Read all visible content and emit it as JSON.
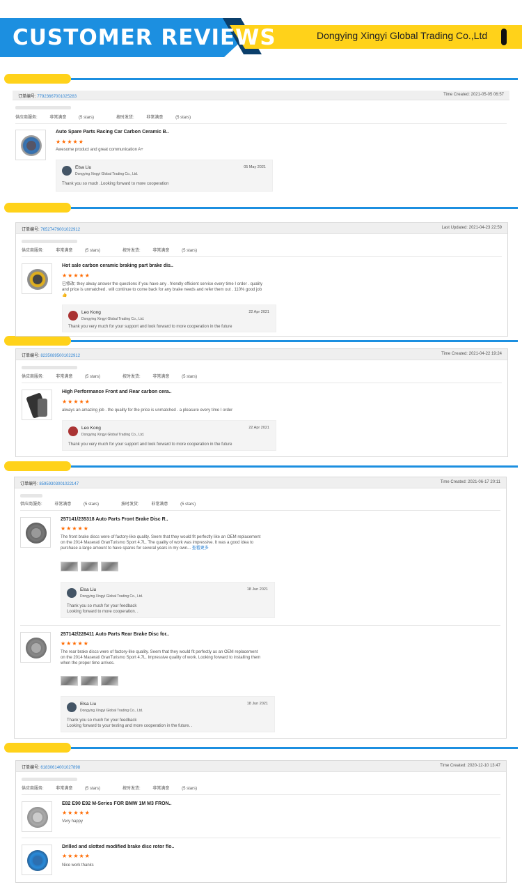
{
  "header": {
    "title": "CUSTOMER REVIEWS",
    "company": "Dongying Xingyi Global Trading Co.,Ltd"
  },
  "labels": {
    "order": "订单编号:",
    "service": "供应商服务:",
    "shipping": "按时发货:",
    "rating": "非常满意",
    "stars": "(5 stars)",
    "star_glyphs": "★★★★★"
  },
  "orders": [
    {
      "number": "77923667001025283",
      "time": "Time Created: 2021-05-05 06:57",
      "items": [
        {
          "name": "Auto Spare Parts Racing Car Carbon Ceramic B..",
          "review": "Awesome product and great communication A+",
          "reply": {
            "name": "Elsa Liu",
            "company": "Dongying Xingyi Global Trading Co., Ltd.",
            "date": "05 May 2021",
            "text": "Thank you so much .Looking forward to more cooperation"
          }
        }
      ]
    },
    {
      "number": "76527479001022912",
      "time": "Last Updated: 2021-04-23 22:59",
      "items": [
        {
          "name": "Hot sale carbon ceramic braking part brake dis..",
          "review": "已修改: they alway answer the questions if you have any . friendly efficient service every time I order . quality and price is unmatched . will continue to come back for any brake  needs and refer them out . 110% good job 👍",
          "reply": {
            "name": "Leo Kong",
            "company": "Dongying Xingyi Global Trading Co., Ltd.",
            "date": "22 Apr 2021",
            "text": "Thank you very much for your support and look forward to more cooperation in the future"
          }
        }
      ]
    },
    {
      "number": "82350895001022912",
      "time": "Time Created: 2021-04-22 19:24",
      "items": [
        {
          "name": "High Performance Front and Rear carbon cera..",
          "review": "always an amazing job . the  quality for the price is unmatched . a pleasure every time I order",
          "reply": {
            "name": "Leo Kong",
            "company": "Dongying Xingyi Global Trading Co., Ltd.",
            "date": "22 Apr 2021",
            "text": "Thank you very much for your support and look forward to more cooperation in the future"
          }
        }
      ]
    },
    {
      "number": "85959303001022147",
      "time": "Time Created: 2021-06-17 20:11",
      "items": [
        {
          "name": "257141/235318 Auto Parts Front Brake Disc R..",
          "review": "The front brake discs were of factory-like quality. Seem that they would fit perfectly like an OEM replacement on the 2014 Maserati GranTurismo Sport 4.7L. The quality of work was impressive. It was a good idea to purchase a large amount to have spares for several years in my own...",
          "more": "查看更多",
          "reply": {
            "name": "Elsa Liu",
            "company": "Dongying Xingyi Global Trading Co., Ltd.",
            "date": "18 Jun 2021",
            "text": "Thank you so much for your feedback\nLooking forward to more cooperation. ."
          }
        },
        {
          "name": "257142/228411 Auto Parts Rear Brake Disc for..",
          "review": "The rear brake discs were of factory-like quality. Seem that they would fit perfectly as an OEM replacement on the 2014 Maserati GranTurismo Sport 4.7L. Impressive quality of work. Looking forward to installing them when the proper time arrives.",
          "reply": {
            "name": "Elsa Liu",
            "company": "Dongying Xingyi Global Trading Co., Ltd.",
            "date": "18 Jun 2021",
            "text": "Thank you so much for your feedback\nLooking forward to your testing and more cooperation in the future. ."
          }
        }
      ]
    },
    {
      "number": "61830614001027898",
      "time": "Time Created: 2020-12-10 13:47",
      "items": [
        {
          "name": "E82 E90 E92 M-Series FOR BMW 1M M3 FRON..",
          "review": "Very happy"
        },
        {
          "name": "Drilled and slotted modified brake disc rotor flo..",
          "review": "Nice work thanks"
        }
      ]
    }
  ]
}
